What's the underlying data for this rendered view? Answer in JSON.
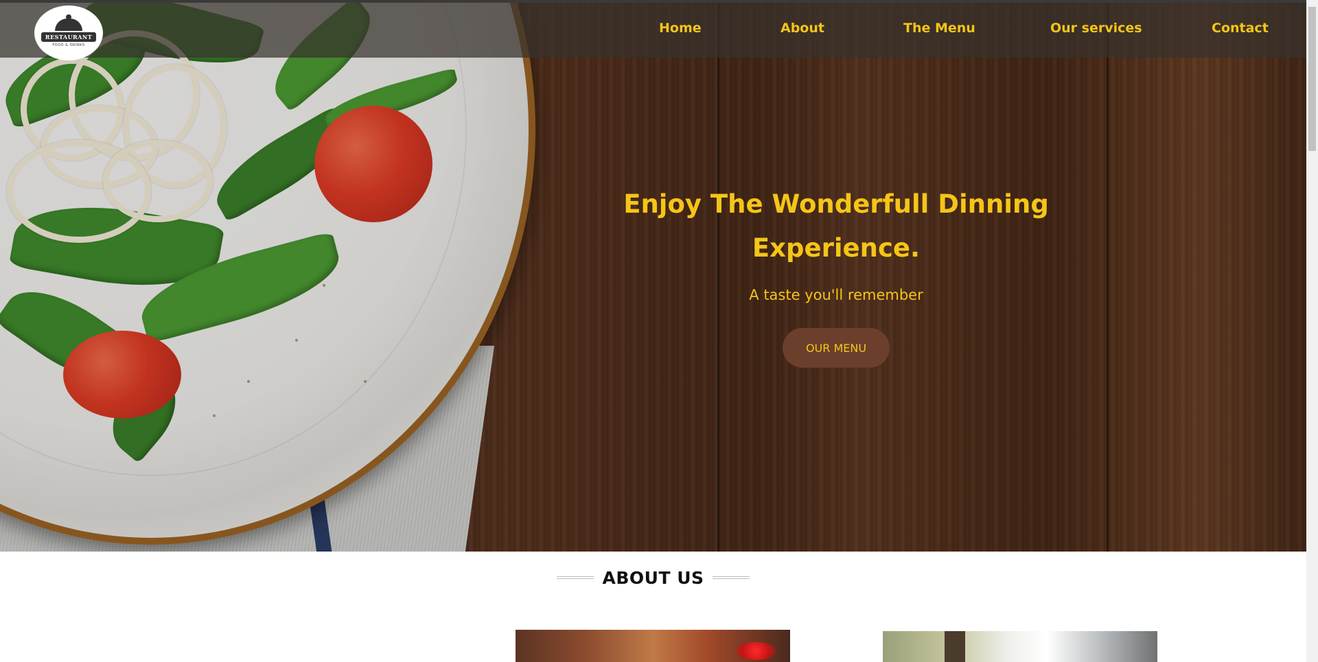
{
  "nav": {
    "logo_text": "RESTAURANT",
    "logo_subtext": "FOOD & DRINKS",
    "links": [
      "Home",
      "About",
      "The Menu",
      "Our services",
      "Contact"
    ]
  },
  "hero": {
    "title_line1": "Enjoy The Wonderfull Dinning",
    "title_line2": "Experience.",
    "subtitle": "A taste you'll remember",
    "button_label": "OUR MENU"
  },
  "about": {
    "heading": "ABOUT US"
  },
  "colors": {
    "accent": "#f5c518",
    "button_bg": "#6b3f2c",
    "navbar_bg": "rgba(55,50,45,0.72)"
  }
}
